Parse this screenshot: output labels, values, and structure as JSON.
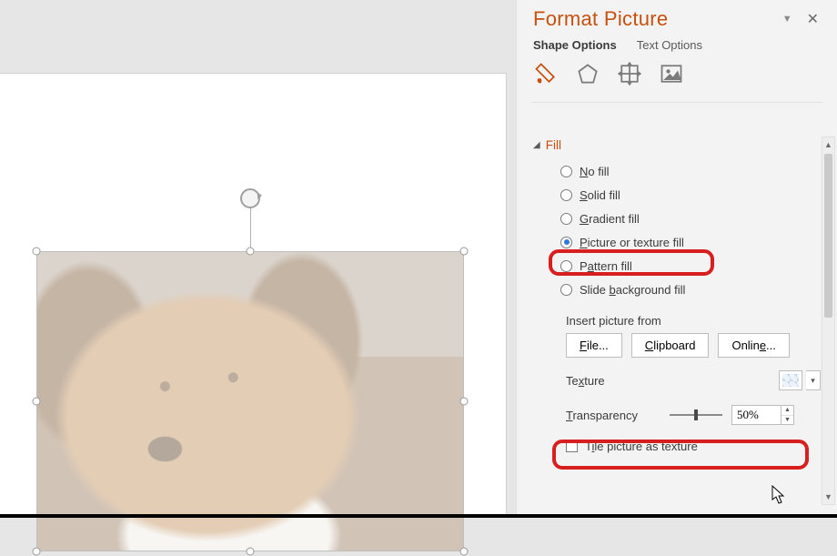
{
  "pane": {
    "title": "Format Picture",
    "tabs": {
      "shape": "Shape Options",
      "text": "Text Options"
    },
    "section": "Fill",
    "fill_options": {
      "no_fill": "No fill",
      "solid": "Solid fill",
      "gradient": "Gradient fill",
      "picture": "Picture or texture fill",
      "pattern": "Pattern fill",
      "slidebg": "Slide background fill",
      "selected": "picture"
    },
    "insert_label": "Insert picture from",
    "buttons": {
      "file": "File...",
      "clipboard": "Clipboard",
      "online": "Online..."
    },
    "texture_label": "Texture",
    "transparency": {
      "label": "Transparency",
      "value": "50%"
    },
    "tile_label": "Tile picture as texture",
    "tile_checked": false
  },
  "colors": {
    "accent": "#c8500f",
    "callout": "#d81e1e"
  }
}
